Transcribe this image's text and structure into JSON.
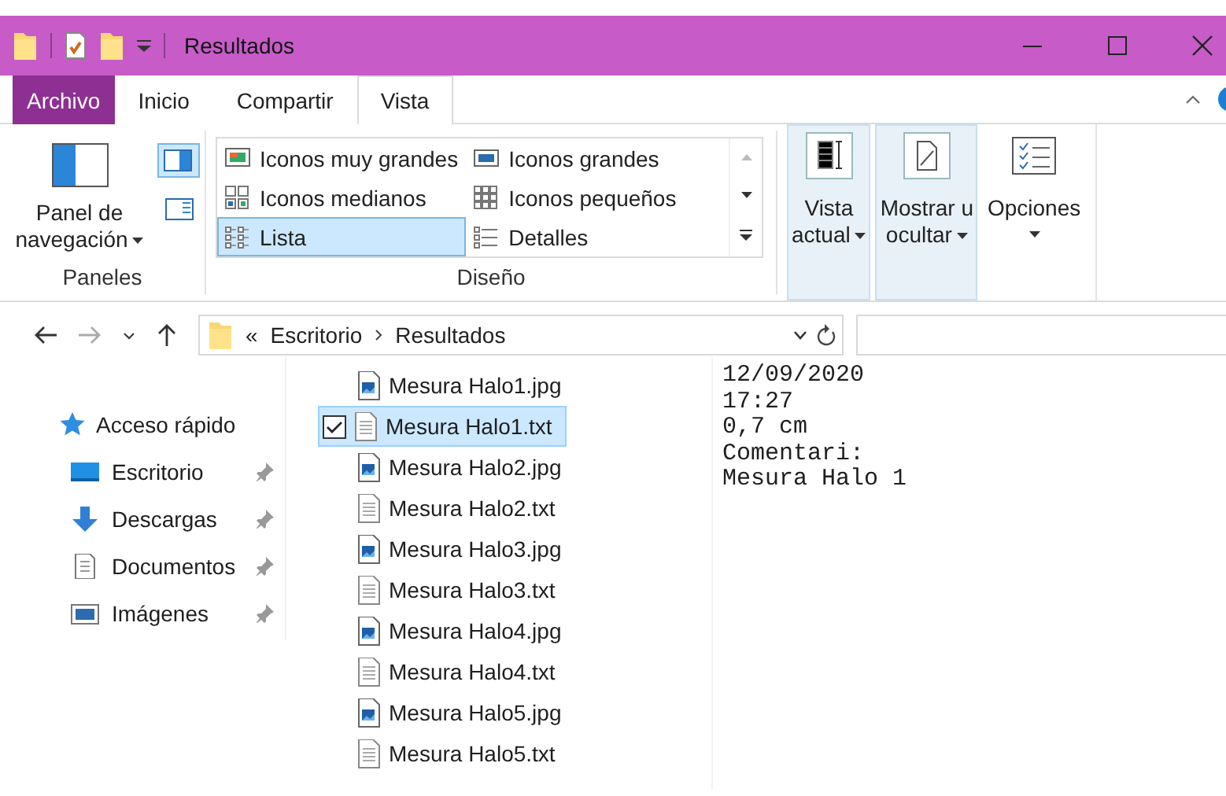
{
  "window": {
    "title": "Resultados"
  },
  "ribbon_tabs": [
    {
      "label": "Archivo",
      "kind": "file",
      "selected": false
    },
    {
      "label": "Inicio",
      "kind": "tab",
      "selected": false
    },
    {
      "label": "Compartir",
      "kind": "tab",
      "selected": false
    },
    {
      "label": "Vista",
      "kind": "tab",
      "selected": true
    }
  ],
  "ribbon": {
    "panes": {
      "nav_button": "Panel de\nnavegación",
      "preview_pane_selected": true,
      "label": "Paneles"
    },
    "layout": {
      "label": "Diseño",
      "options": [
        {
          "label": "Iconos muy grandes",
          "kind": "xl",
          "selected": false
        },
        {
          "label": "Iconos grandes",
          "kind": "lg",
          "selected": false
        },
        {
          "label": "Iconos medianos",
          "kind": "md",
          "selected": false
        },
        {
          "label": "Iconos pequeños",
          "kind": "sm",
          "selected": false
        },
        {
          "label": "Lista",
          "kind": "list",
          "selected": true
        },
        {
          "label": "Detalles",
          "kind": "details",
          "selected": false
        }
      ]
    },
    "buttons": [
      {
        "label": "Vista\nactual",
        "kind": "current-view",
        "highlighted": true
      },
      {
        "label": "Mostrar u\nocultar",
        "kind": "show-hide",
        "highlighted": true
      },
      {
        "label": "Opciones",
        "kind": "options",
        "highlighted": false
      }
    ]
  },
  "address": {
    "overflow": "«",
    "path": [
      "Escritorio",
      "Resultados"
    ]
  },
  "nav": [
    {
      "label": "Acceso rápido",
      "kind": "quick-access",
      "pinned": false
    },
    {
      "label": "Escritorio",
      "kind": "desktop",
      "pinned": true
    },
    {
      "label": "Descargas",
      "kind": "downloads",
      "pinned": true
    },
    {
      "label": "Documentos",
      "kind": "documents",
      "pinned": true
    },
    {
      "label": "Imágenes",
      "kind": "pictures",
      "pinned": true
    }
  ],
  "files": [
    {
      "name": "Mesura Halo1.jpg",
      "kind": "image",
      "selected": false
    },
    {
      "name": "Mesura Halo1.txt",
      "kind": "text",
      "selected": true
    },
    {
      "name": "Mesura Halo2.jpg",
      "kind": "image",
      "selected": false
    },
    {
      "name": "Mesura Halo2.txt",
      "kind": "text",
      "selected": false
    },
    {
      "name": "Mesura Halo3.jpg",
      "kind": "image",
      "selected": false
    },
    {
      "name": "Mesura Halo3.txt",
      "kind": "text",
      "selected": false
    },
    {
      "name": "Mesura Halo4.jpg",
      "kind": "image",
      "selected": false
    },
    {
      "name": "Mesura Halo4.txt",
      "kind": "text",
      "selected": false
    },
    {
      "name": "Mesura Halo5.jpg",
      "kind": "image",
      "selected": false
    },
    {
      "name": "Mesura Halo5.txt",
      "kind": "text",
      "selected": false
    }
  ],
  "preview": {
    "lines": [
      "12/09/2020",
      "17:27",
      "0,7 cm",
      "Comentari:",
      "Mesura Halo 1"
    ]
  }
}
